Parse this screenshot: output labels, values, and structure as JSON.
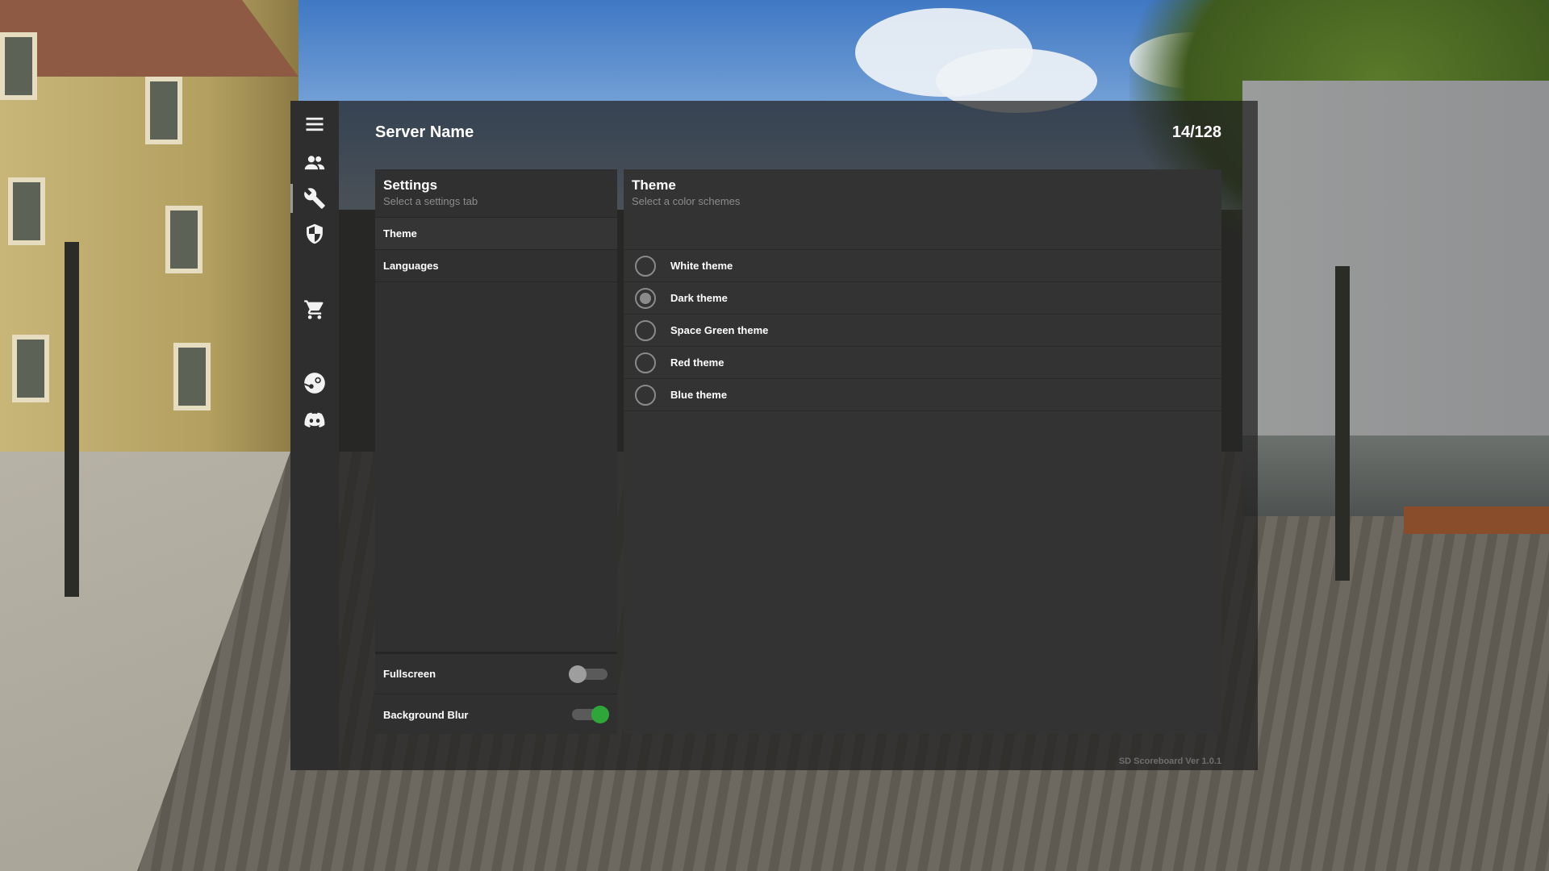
{
  "header": {
    "server_name": "Server Name",
    "player_count": "14/128"
  },
  "rail": {
    "items": [
      {
        "icon": "menu-icon"
      },
      {
        "icon": "users-icon"
      },
      {
        "icon": "wrench-icon",
        "active": true
      },
      {
        "icon": "shield-icon"
      },
      {
        "icon": "cart-icon"
      },
      {
        "icon": "steam-icon"
      },
      {
        "icon": "discord-icon"
      }
    ]
  },
  "settings": {
    "title": "Settings",
    "subtitle": "Select a settings tab",
    "tabs": [
      {
        "label": "Theme",
        "active": true
      },
      {
        "label": "Languages"
      }
    ],
    "toggles": [
      {
        "label": "Fullscreen",
        "on": false
      },
      {
        "label": "Background Blur",
        "on": true
      }
    ]
  },
  "theme": {
    "title": "Theme",
    "subtitle": "Select a color schemes",
    "options": [
      {
        "label": "White theme",
        "selected": false
      },
      {
        "label": "Dark theme",
        "selected": true
      },
      {
        "label": "Space Green theme",
        "selected": false
      },
      {
        "label": "Red theme",
        "selected": false
      },
      {
        "label": "Blue theme",
        "selected": false
      }
    ]
  },
  "footer": {
    "version": "SD Scoreboard Ver 1.0.1"
  },
  "colors": {
    "toggle_on": "#2ea63a",
    "panel_bg": "#303030",
    "rail_bg": "#2e2e2e"
  }
}
